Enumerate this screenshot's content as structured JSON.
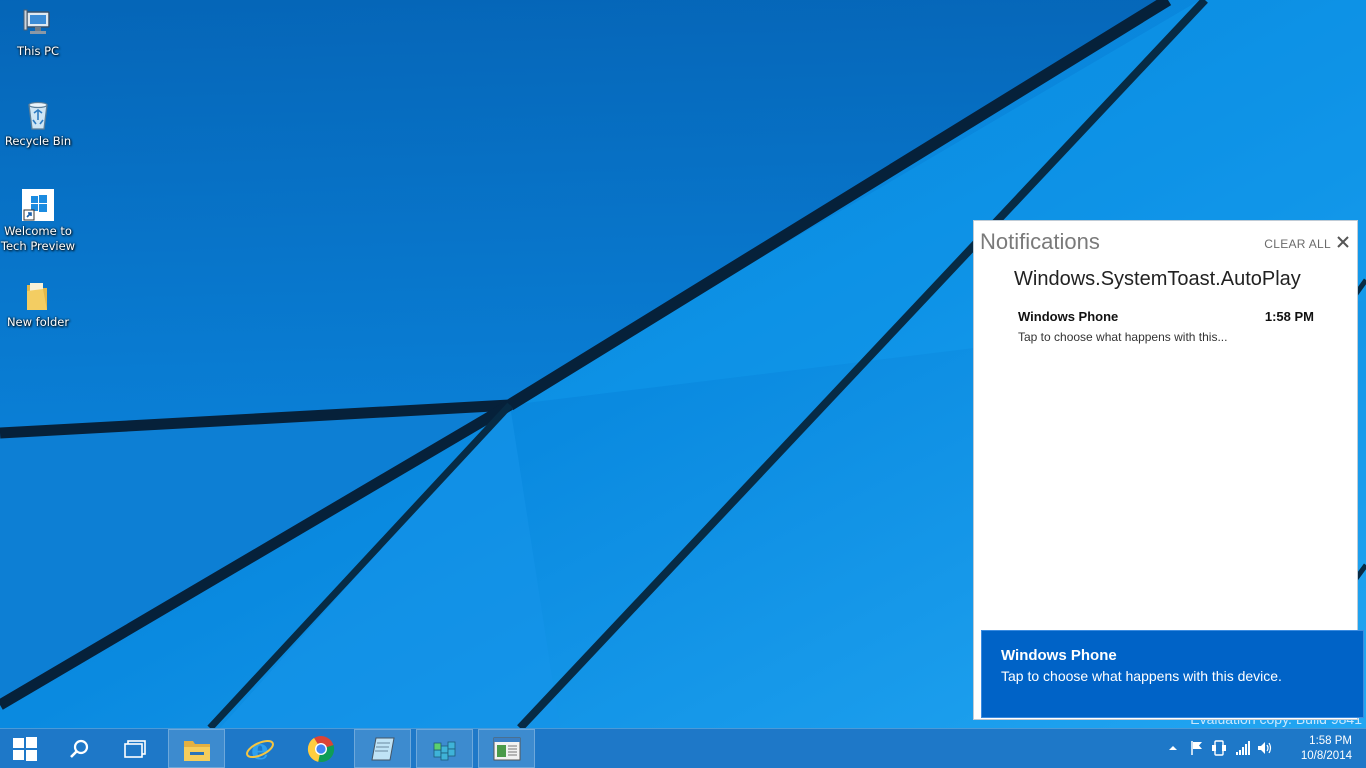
{
  "desktop": {
    "icons": [
      {
        "label": "This PC",
        "icon": "computer-icon"
      },
      {
        "label": "Recycle Bin",
        "icon": "recycle-bin-icon"
      },
      {
        "label": "Welcome to Tech Preview",
        "label_line1": "Welcome to",
        "label_line2": "Tech Preview",
        "icon": "windows-logo-shortcut-icon"
      },
      {
        "label": "New folder",
        "icon": "folder-icon"
      }
    ]
  },
  "notifications": {
    "title": "Notifications",
    "clear_all_label": "CLEAR ALL",
    "group_title": "Windows.SystemToast.AutoPlay",
    "items": [
      {
        "title": "Windows Phone",
        "time": "1:58 PM",
        "body": "Tap to choose what happens with this..."
      }
    ]
  },
  "toast": {
    "title": "Windows Phone",
    "body": "Tap to choose what happens with this device."
  },
  "watermark": "Evaluation copy. Build 9841",
  "taskbar": {
    "apps": [
      "start-icon",
      "search-icon",
      "task-view-icon",
      "file-explorer-icon",
      "internet-explorer-icon",
      "chrome-icon",
      "notepad-icon",
      "registry-editor-icon",
      "app-window-icon"
    ],
    "tray_icons": [
      "show-hidden-icons-icon",
      "action-center-flag-icon",
      "device-icon",
      "network-signal-icon",
      "volume-icon"
    ],
    "clock": {
      "time": "1:58 PM",
      "date": "10/8/2014"
    }
  },
  "colors": {
    "accent": "#0a7fd6",
    "toast": "#0063c7",
    "taskbar": "#1e78c8"
  }
}
